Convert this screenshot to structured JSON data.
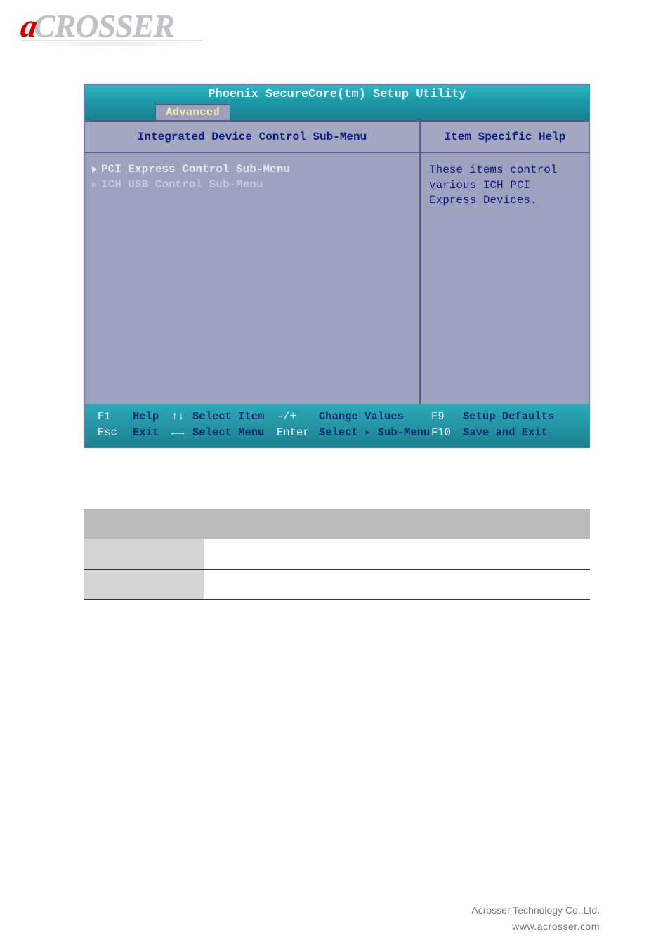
{
  "logo": {
    "prefix": "a",
    "rest": "CROSSER"
  },
  "bios": {
    "title": "Phoenix SecureCore(tm) Setup Utility",
    "tab": "Advanced",
    "left_header": "Integrated Device Control Sub-Menu",
    "right_header": "Item Specific Help",
    "menu": [
      "PCI Express Control Sub-Menu",
      "ICH USB Control Sub-Menu"
    ],
    "help_text": "These items control various ICH PCI Express Devices.",
    "footer": {
      "r1": {
        "k1": "F1",
        "a1": "Help",
        "i1": "↑↓",
        "a2": "Select Item",
        "i2": "-/+",
        "a3": "Change Values",
        "k2": "F9",
        "a4": "Setup Defaults"
      },
      "r2": {
        "k1": "Esc",
        "a1": "Exit",
        "i1": "←→",
        "a2": "Select Menu",
        "i2": "Enter",
        "a3": "Select ▸ Sub-Menu",
        "k2": "F10",
        "a4": "Save and Exit"
      }
    }
  },
  "table": {
    "headers": [
      "",
      "",
      ""
    ],
    "rows": [
      [
        "",
        "",
        ""
      ],
      [
        "",
        "",
        ""
      ]
    ]
  },
  "footer": {
    "company": "Acrosser Technology Co.,Ltd.",
    "url": "www.acrosser.com"
  }
}
